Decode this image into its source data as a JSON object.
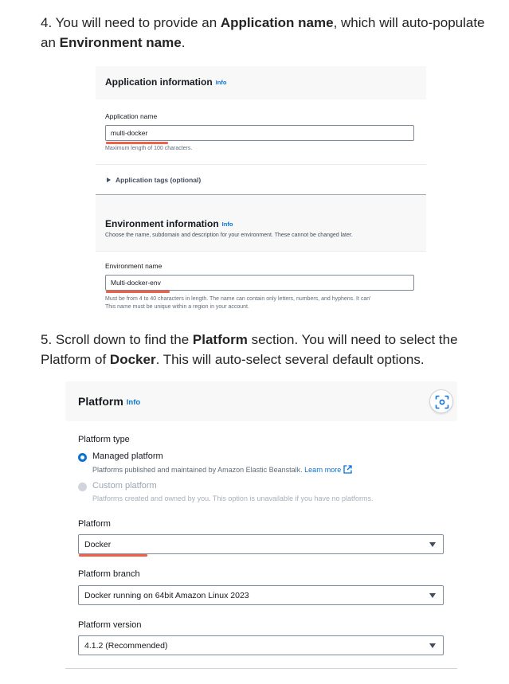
{
  "step4": {
    "t1": "4. You will need to provide an ",
    "b1": "Application name",
    "t2": ", which will auto-populate an ",
    "b2": "Environment name",
    "t3": "."
  },
  "app_info": {
    "title": "Application information",
    "info": "Info",
    "app_name_label": "Application name",
    "app_name_value": "multi-docker",
    "app_name_hint": "Maximum length of 100 characters.",
    "tags_label": "Application tags (optional)"
  },
  "env_info": {
    "title": "Environment information",
    "info": "Info",
    "description": "Choose the name, subdomain and description for your environment. These cannot be changed later.",
    "env_name_label": "Environment name",
    "env_name_value": "Multi-docker-env",
    "env_name_hint_1": "Must be from 4 to 40 characters in length. The name can contain only letters, numbers, and hyphens. It can'",
    "env_name_hint_2": "This name must be unique within a region in your account."
  },
  "step5": {
    "t1": "5. Scroll down to find the ",
    "b1": "Platform",
    "t2": " section. You will need to select the Platform of ",
    "b2": "Docker",
    "t3": ". This will auto-select several default options."
  },
  "platform": {
    "title": "Platform",
    "info": "Info",
    "type_label": "Platform type",
    "managed_label": "Managed platform",
    "managed_desc": "Platforms published and maintained by Amazon Elastic Beanstalk.",
    "learn_more": "Learn more",
    "custom_label": "Custom platform",
    "custom_desc": "Platforms created and owned by you. This option is unavailable if you have no platforms.",
    "platform_label": "Platform",
    "platform_value": "Docker",
    "branch_label": "Platform branch",
    "branch_value": "Docker running on 64bit Amazon Linux 2023",
    "version_label": "Platform version",
    "version_value": "4.1.2 (Recommended)"
  },
  "colors": {
    "accent": "#0972d3",
    "highlight": "#f0614a"
  }
}
